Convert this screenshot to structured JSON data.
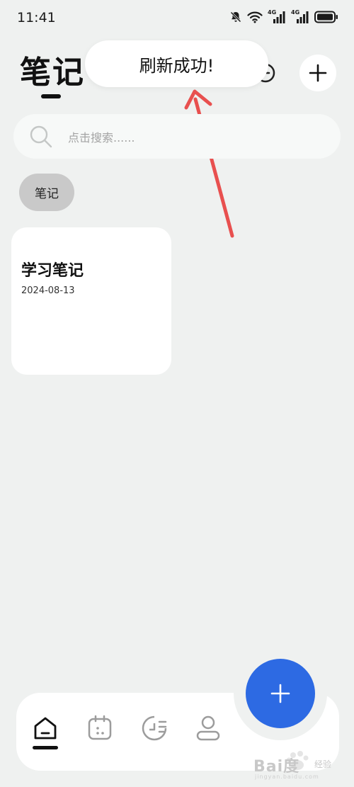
{
  "status_bar": {
    "time": "11:41",
    "network_1": "4G",
    "network_2": "4G",
    "icons": [
      "mute-bell-icon",
      "wifi-icon",
      "signal-icon",
      "signal-icon",
      "battery-icon"
    ]
  },
  "header": {
    "title": "笔记",
    "icons": [
      "sync-icon",
      "clock-icon",
      "add-icon"
    ]
  },
  "toast": {
    "message": "刷新成功!"
  },
  "search": {
    "placeholder": "点击搜索......"
  },
  "category_chips": [
    {
      "label": "笔记"
    }
  ],
  "notes": [
    {
      "title": "学习笔记",
      "date": "2024-08-13"
    }
  ],
  "bottom_nav": {
    "items": [
      {
        "icon": "home-icon",
        "active": true
      },
      {
        "icon": "calendar-icon",
        "active": false
      },
      {
        "icon": "history-icon",
        "active": false
      },
      {
        "icon": "profile-icon",
        "active": false
      }
    ]
  },
  "fab": {
    "icon": "add-icon"
  },
  "annotation": {
    "color": "#e8504f"
  },
  "watermark": {
    "brand": "Bai度",
    "sub": "经验",
    "url": "jingyan.baidu.com"
  },
  "colors": {
    "background": "#eff1f0",
    "accent": "#2d6ae3",
    "chip": "#c9c9c9",
    "card": "#ffffff"
  }
}
